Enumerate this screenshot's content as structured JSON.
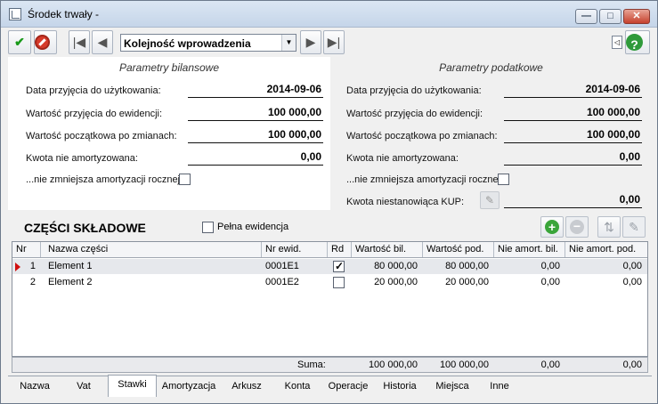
{
  "window": {
    "title": "Środek trwały -",
    "min": "—",
    "max": "□",
    "close": "✕"
  },
  "toolbar": {
    "order_value": "Kolejność wprowadzenia",
    "help": "?",
    "first": "|◀",
    "prev": "◀",
    "next": "▶",
    "last": "▶|",
    "collapse": "◁"
  },
  "left": {
    "title": "Parametry bilansowe",
    "date_label": "Data przyjęcia do użytkowania:",
    "date_value": "2014-09-06",
    "wp_label": "Wartość przyjęcia do ewidencji:",
    "wp_value": "100 000,00",
    "wpz_label": "Wartość początkowa po zmianach:",
    "wpz_value": "100 000,00",
    "kna_label": "Kwota nie amortyzowana:",
    "kna_value": "0,00",
    "nzm_label": "...nie zmniejsza amortyzacji rocznej"
  },
  "right": {
    "title": "Parametry podatkowe",
    "date_label": "Data przyjęcia do użytkowania:",
    "date_value": "2014-09-06",
    "wp_label": "Wartość przyjęcia do ewidencji:",
    "wp_value": "100 000,00",
    "wpz_label": "Wartość początkowa po zmianach:",
    "wpz_value": "100 000,00",
    "kna_label": "Kwota nie amortyzowana:",
    "kna_value": "0,00",
    "nzm_label": "...nie zmniejsza amortyzacji rocznej",
    "kup_label": "Kwota niestanowiąca KUP:",
    "kup_value": "0,00"
  },
  "parts": {
    "title": "CZĘŚCI SKŁADOWE",
    "full_label": "Pełna ewidencja",
    "columns": [
      "Nr",
      "Nazwa części",
      "Nr ewid.",
      "Rd",
      "Wartość bil.",
      "Wartość pod.",
      "Nie amort. bil.",
      "Nie amort. pod."
    ],
    "rows": [
      {
        "nr": "1",
        "name": "Element 1",
        "ewid": "0001E1",
        "rd": true,
        "wbil": "80 000,00",
        "wpod": "80 000,00",
        "nabil": "0,00",
        "napod": "0,00"
      },
      {
        "nr": "2",
        "name": "Element 2",
        "ewid": "0001E2",
        "rd": false,
        "wbil": "20 000,00",
        "wpod": "20 000,00",
        "nabil": "0,00",
        "napod": "0,00"
      }
    ],
    "sum": {
      "label": "Suma:",
      "wbil": "100 000,00",
      "wpod": "100 000,00",
      "nabil": "0,00",
      "napod": "0,00"
    }
  },
  "tabs": [
    "Nazwa",
    "Vat",
    "Stawki",
    "Amortyzacja",
    "Arkusz",
    "Konta",
    "Operacje",
    "Historia",
    "Miejsca",
    "Inne"
  ],
  "active_tab": "Stawki"
}
